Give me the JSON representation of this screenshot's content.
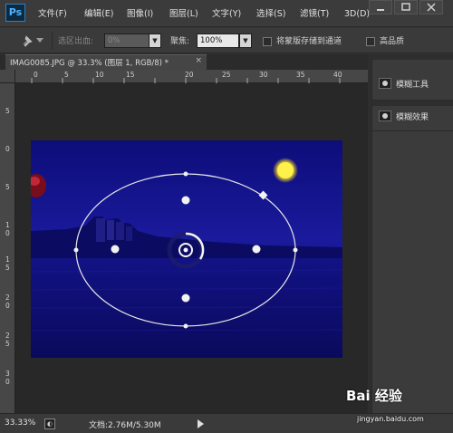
{
  "app": {
    "logo_text": "Ps",
    "menu": [
      "文件(F)",
      "编辑(E)",
      "图像(I)",
      "图层(L)",
      "文字(Y)",
      "选择(S)",
      "滤镜(T)",
      "3D(D)"
    ]
  },
  "options_bar": {
    "selection_bleed_label": "选区出血:",
    "selection_bleed_value": "0%",
    "focus_label": "聚焦:",
    "focus_value": "100%",
    "save_mask_label": "将蒙版存储到通道",
    "high_quality_label": "高品质"
  },
  "document_tab": {
    "title": "IMAG0085.JPG @ 33.3% (图层 1, RGB/8) *",
    "close": "×"
  },
  "rulers": {
    "horizontal": [
      "0",
      "5",
      "10",
      "15",
      "20",
      "25",
      "30",
      "35",
      "40"
    ],
    "vertical": [
      "5",
      "0",
      "5",
      "1 0",
      "1 5",
      "2 0",
      "2 5",
      "3 0",
      "3 5"
    ]
  },
  "panels": {
    "items": [
      {
        "label": "模糊工具",
        "icon": "blur-tool-icon"
      },
      {
        "label": "模糊效果",
        "icon": "blur-effects-icon"
      }
    ]
  },
  "status_bar": {
    "zoom": "33.33%",
    "doc_info": "文档:2.76M/5.30M"
  },
  "watermark": {
    "logo": "Bai 经验",
    "url": "jingyan.baidu.com"
  },
  "colors": {
    "accent": "#4fb3ff",
    "image_blue": "#1a1a9c",
    "moon": "#ffee33",
    "overlay": "#e8e8e8"
  }
}
